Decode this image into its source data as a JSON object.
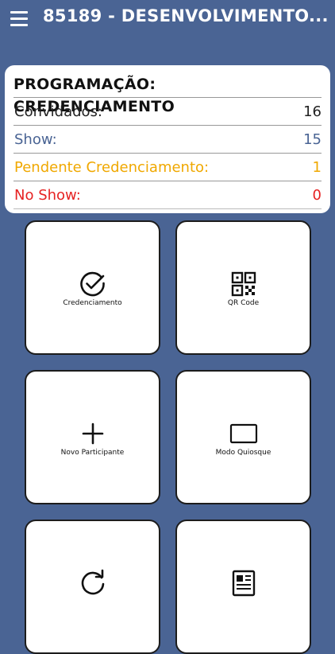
{
  "header": {
    "title": "85189 - DESENVOLVIMENTO...",
    "menu_icon": "hamburger-menu-icon"
  },
  "summary": {
    "title": "PROGRAMAÇÃO: CREDENCIAMENTO",
    "rows": [
      {
        "label": "Convidados:",
        "value": "16",
        "color": "#222222"
      },
      {
        "label": "Show:",
        "value": "15",
        "color": "#4a6494"
      },
      {
        "label": "Pendente Credenciamento:",
        "value": "1",
        "color": "#f0a800"
      },
      {
        "label": "No Show:",
        "value": "0",
        "color": "#e62222"
      }
    ]
  },
  "tiles": [
    {
      "label": "Credenciamento",
      "icon": "check-circle-icon"
    },
    {
      "label": "QR Code",
      "icon": "qr-code-icon"
    },
    {
      "label": "Novo Participante",
      "icon": "plus-icon"
    },
    {
      "label": "Modo Quiosque",
      "icon": "tablet-icon"
    },
    {
      "label": "",
      "icon": "refresh-icon"
    },
    {
      "label": "",
      "icon": "newspaper-icon"
    }
  ],
  "colors": {
    "background": "#4a6494",
    "card": "#ffffff",
    "show": "#4a6494",
    "pending": "#f0a800",
    "no_show": "#e62222"
  }
}
